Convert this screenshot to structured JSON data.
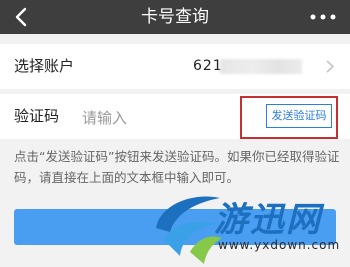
{
  "navbar": {
    "title": "卡号查询",
    "back_icon": "chevron-left-icon",
    "more_icon": "more-dots-icon",
    "background": "#3e3e3e"
  },
  "account": {
    "label": "选择账户",
    "value_prefix": "621",
    "chevron_icon": "chevron-right-icon"
  },
  "verification": {
    "label": "验证码",
    "placeholder": "请输入",
    "value": "",
    "send_button": "发送验证码",
    "button_color": "#2a7ee0",
    "highlight_color": "#c33131"
  },
  "hint": "点击“发送验证码”按钮来发送验证码。如果你已经取得验证码，请直接在上面的文本框中输入即可。",
  "submit": {
    "label": "",
    "color": "#4a9ef2"
  },
  "watermark": {
    "text": "游迅网",
    "url": "www.yxdown.com"
  }
}
